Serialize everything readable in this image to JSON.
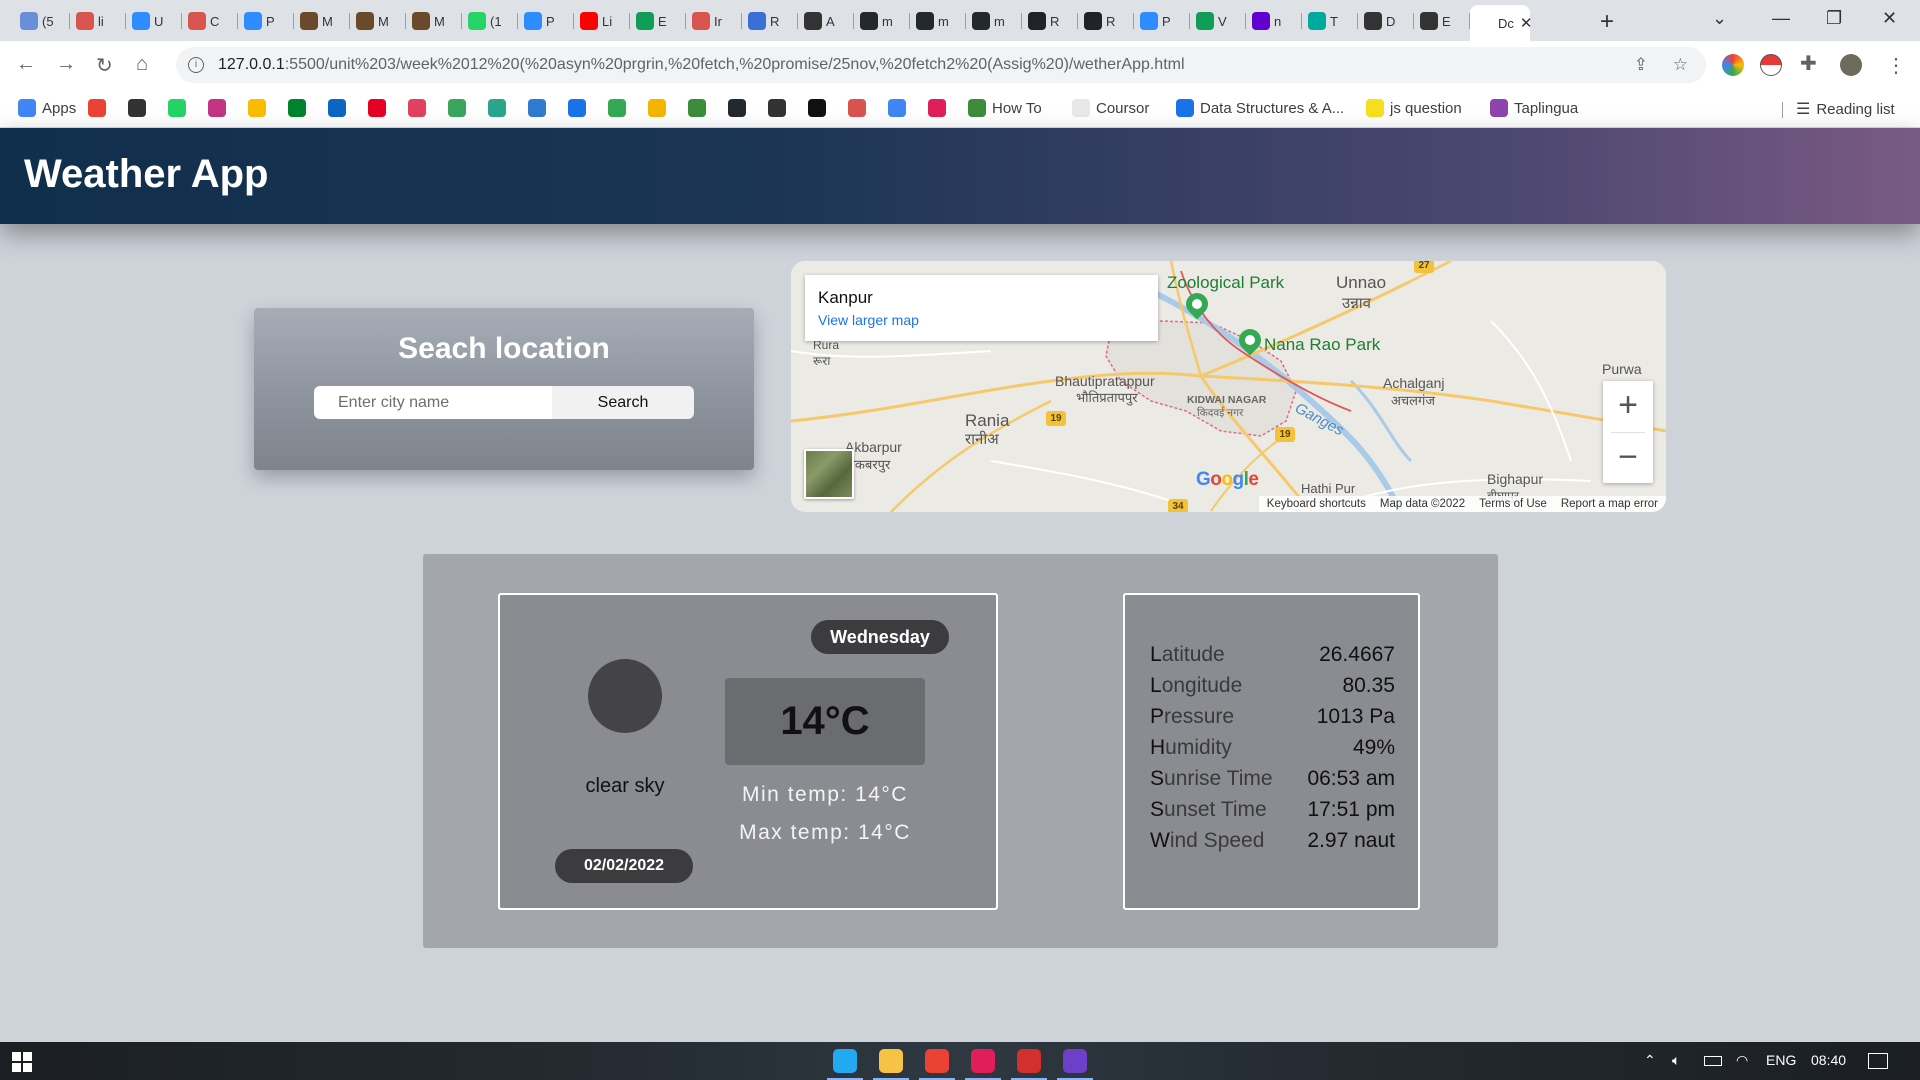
{
  "browser": {
    "tabs": [
      {
        "title": "(5",
        "color": "#6a8ed8"
      },
      {
        "title": "li",
        "color": "#d9534f"
      },
      {
        "title": "U",
        "color": "#2d8cff"
      },
      {
        "title": "C",
        "color": "#d9534f"
      },
      {
        "title": "P",
        "color": "#2d8cff"
      },
      {
        "title": "M",
        "color": "#6b4a2b"
      },
      {
        "title": "M",
        "color": "#6b4a2b"
      },
      {
        "title": "M",
        "color": "#6b4a2b"
      },
      {
        "title": "(1",
        "color": "#25d366"
      },
      {
        "title": "P",
        "color": "#2d8cff"
      },
      {
        "title": "Li",
        "color": "#ff0000"
      },
      {
        "title": "E",
        "color": "#0f9d58"
      },
      {
        "title": "Ir",
        "color": "#d9534f"
      },
      {
        "title": "R",
        "color": "#3b6fd8"
      },
      {
        "title": "A",
        "color": "#333333"
      },
      {
        "title": "m",
        "color": "#24292e"
      },
      {
        "title": "m",
        "color": "#24292e"
      },
      {
        "title": "m",
        "color": "#24292e"
      },
      {
        "title": "R",
        "color": "#20232a"
      },
      {
        "title": "R",
        "color": "#20232a"
      },
      {
        "title": "P",
        "color": "#2d8cff"
      },
      {
        "title": "V",
        "color": "#0f9d58"
      },
      {
        "title": "n",
        "color": "#6001d2"
      },
      {
        "title": "T",
        "color": "#00a99d"
      },
      {
        "title": "D",
        "color": "#333333"
      },
      {
        "title": "E",
        "color": "#333333"
      },
      {
        "title": "Dc",
        "color": "#ffffff"
      }
    ],
    "url_host": "127.0.0.1",
    "url_path": ":5500/unit%203/week%2012%20(%20asyn%20prgrin,%20fetch,%20promise/25nov,%20fetch2%20(Assig%20)/wetherApp.html",
    "bookmarks": [
      {
        "label": "Apps",
        "color": "#4285f4"
      },
      {
        "label": "",
        "color": "#ea4335"
      },
      {
        "label": "",
        "color": "#333333"
      },
      {
        "label": "",
        "color": "#25d366"
      },
      {
        "label": "",
        "color": "#c13584"
      },
      {
        "label": "",
        "color": "#fbbc04"
      },
      {
        "label": "",
        "color": "#00832d"
      },
      {
        "label": "",
        "color": "#0a66c2"
      },
      {
        "label": "",
        "color": "#e60023"
      },
      {
        "label": "",
        "color": "#e4405f"
      },
      {
        "label": "",
        "color": "#3ba55d"
      },
      {
        "label": "",
        "color": "#2ca58d"
      },
      {
        "label": "",
        "color": "#2e7bcf"
      },
      {
        "label": "",
        "color": "#1a73e8"
      },
      {
        "label": "",
        "color": "#34a853"
      },
      {
        "label": "",
        "color": "#f4b400"
      },
      {
        "label": "",
        "color": "#3c8c3c"
      },
      {
        "label": "",
        "color": "#24292e"
      },
      {
        "label": "",
        "color": "#333333"
      },
      {
        "label": "",
        "color": "#111111"
      },
      {
        "label": "",
        "color": "#d9534f"
      },
      {
        "label": "",
        "color": "#4285f4"
      },
      {
        "label": "",
        "color": "#e01e5a"
      },
      {
        "label": "How To",
        "color": "#3c8c3c"
      },
      {
        "label": "Coursor",
        "color": "#e8e8e8"
      },
      {
        "label": "Data Structures & A...",
        "color": "#1a73e8"
      },
      {
        "label": "js question",
        "color": "#f7df1e"
      },
      {
        "label": "Taplingua",
        "color": "#8e44ad"
      }
    ],
    "reading_list": "Reading list"
  },
  "app": {
    "title": "Weather App",
    "search": {
      "heading": "Seach location",
      "placeholder": "Enter city name",
      "button": "Search"
    },
    "map": {
      "place": "Kanpur",
      "larger_map": "View larger map",
      "labels": {
        "zoo": "Zoological Park",
        "unnao": "Unnao",
        "unnao_hi": "उन्नाव",
        "nana": "Nana Rao Park",
        "purwa": "Purwa",
        "rura": "Rura",
        "rura_hi": "रूरा",
        "bhauti": "Bhautipratappur",
        "bhauti_hi": "भौतिप्रतापपुर",
        "kidwai": "KIDWAI NAGAR",
        "kidwai_hi": "किदवई नगर",
        "achal": "Achalganj",
        "achal_hi": "अचलगंज",
        "ganges": "Ganges",
        "rania": "Rania",
        "rania_hi": "रानीअ",
        "akbarpur": "Akbarpur",
        "akbarpur_hi": "अकबरपुर",
        "bighapur": "Bighapur",
        "bighapur_hi": "बीघापुर",
        "hathi": "Hathi Pur"
      },
      "shields": [
        "27",
        "19",
        "19",
        "34"
      ],
      "google": "Google",
      "footer": [
        "Keyboard shortcuts",
        "Map data ©2022",
        "Terms of Use",
        "Report a map error"
      ],
      "zoom_in": "+",
      "zoom_out": "−"
    },
    "current": {
      "day": "Wednesday",
      "temp": "14°C",
      "description": "clear sky",
      "min": "Min temp: 14°C",
      "max": "Max temp: 14°C",
      "date": "02/02/2022"
    },
    "details": [
      {
        "label": "Latitude",
        "value": "26.4667"
      },
      {
        "label": "Longitude",
        "value": "80.35"
      },
      {
        "label": "Pressure",
        "value": "1013 Pa"
      },
      {
        "label": "Humidity",
        "value": "49%"
      },
      {
        "label": "Sunrise Time",
        "value": "06:53 am"
      },
      {
        "label": "Sunset Time",
        "value": "17:51 pm"
      },
      {
        "label": "Wind Speed",
        "value": "2.97 naut"
      }
    ]
  },
  "taskbar": {
    "apps": [
      {
        "name": "vscode-icon",
        "color": "#23a9f2"
      },
      {
        "name": "file-explorer-icon",
        "color": "#f6c344"
      },
      {
        "name": "chrome-icon",
        "color": "#ea4335"
      },
      {
        "name": "slack-icon",
        "color": "#e01e5a"
      },
      {
        "name": "recorder-icon",
        "color": "#d32f2f"
      },
      {
        "name": "github-desktop-icon",
        "color": "#6e40c9"
      }
    ],
    "lang": "ENG",
    "time": "08:40"
  }
}
